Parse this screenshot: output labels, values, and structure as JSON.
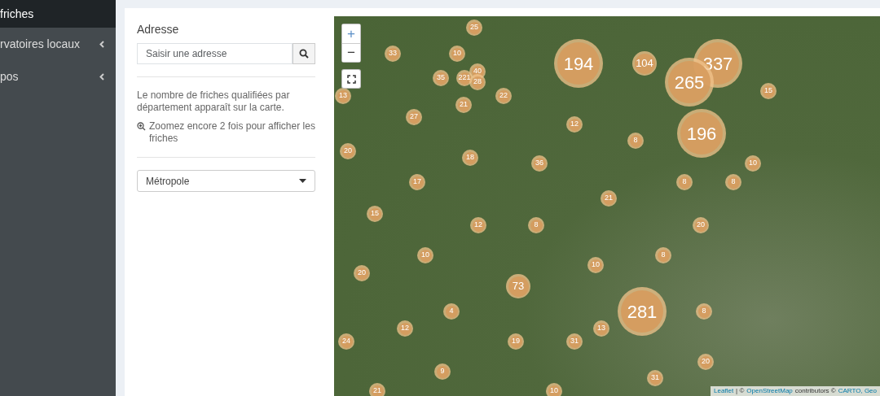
{
  "sidebar": {
    "items": [
      {
        "label": "friches",
        "selected": true,
        "has_children": false
      },
      {
        "label": "rvatoires locaux",
        "selected": false,
        "has_children": true
      },
      {
        "label": "pos",
        "selected": false,
        "has_children": true
      }
    ]
  },
  "panel": {
    "address_label": "Adresse",
    "address_field": {
      "placeholder": "Saisir une adresse"
    },
    "info": "Le nombre de friches qualifiées par département apparaît sur la carte.",
    "zoom_hint": "Zoomez encore 2 fois pour afficher les friches",
    "region_select": {
      "value": "Métropole"
    }
  },
  "map": {
    "zoom_in": "+",
    "zoom_out": "−",
    "clusters": [
      {
        "count": "25",
        "kind": "small"
      },
      {
        "count": "33",
        "kind": "small"
      },
      {
        "count": "10",
        "kind": "small"
      },
      {
        "count": "194",
        "kind": "large"
      },
      {
        "count": "104",
        "kind": "medium"
      },
      {
        "count": "337",
        "kind": "large"
      },
      {
        "count": "40",
        "kind": "small"
      },
      {
        "count": "35",
        "kind": "small"
      },
      {
        "count": "221",
        "kind": "small"
      },
      {
        "count": "28",
        "kind": "small"
      },
      {
        "count": "265",
        "kind": "large"
      },
      {
        "count": "15",
        "kind": "small"
      },
      {
        "count": "13",
        "kind": "small"
      },
      {
        "count": "22",
        "kind": "small"
      },
      {
        "count": "21",
        "kind": "small"
      },
      {
        "count": "27",
        "kind": "small"
      },
      {
        "count": "12",
        "kind": "small"
      },
      {
        "count": "196",
        "kind": "large"
      },
      {
        "count": "8",
        "kind": "small"
      },
      {
        "count": "20",
        "kind": "small"
      },
      {
        "count": "18",
        "kind": "small"
      },
      {
        "count": "36",
        "kind": "small"
      },
      {
        "count": "10",
        "kind": "small"
      },
      {
        "count": "17",
        "kind": "small"
      },
      {
        "count": "8",
        "kind": "small"
      },
      {
        "count": "8",
        "kind": "small"
      },
      {
        "count": "21",
        "kind": "small"
      },
      {
        "count": "15",
        "kind": "small"
      },
      {
        "count": "12",
        "kind": "small"
      },
      {
        "count": "8",
        "kind": "small"
      },
      {
        "count": "20",
        "kind": "small"
      },
      {
        "count": "10",
        "kind": "small"
      },
      {
        "count": "8",
        "kind": "small"
      },
      {
        "count": "10",
        "kind": "small"
      },
      {
        "count": "20",
        "kind": "small"
      },
      {
        "count": "73",
        "kind": "medium"
      },
      {
        "count": "4",
        "kind": "small"
      },
      {
        "count": "281",
        "kind": "large"
      },
      {
        "count": "8",
        "kind": "small"
      },
      {
        "count": "12",
        "kind": "small"
      },
      {
        "count": "13",
        "kind": "small"
      },
      {
        "count": "24",
        "kind": "small"
      },
      {
        "count": "19",
        "kind": "small"
      },
      {
        "count": "31",
        "kind": "small"
      },
      {
        "count": "20",
        "kind": "small"
      },
      {
        "count": "9",
        "kind": "small"
      },
      {
        "count": "31",
        "kind": "small"
      },
      {
        "count": "21",
        "kind": "small"
      },
      {
        "count": "10",
        "kind": "small"
      }
    ],
    "attribution": [
      {
        "text": "Leaflet",
        "link": true
      },
      {
        "text": "| ©",
        "link": false
      },
      {
        "text": "OpenStreetMap",
        "link": true
      },
      {
        "text": "contributors ©",
        "link": false
      },
      {
        "text": "CARTO, Geo",
        "link": true
      }
    ]
  }
}
